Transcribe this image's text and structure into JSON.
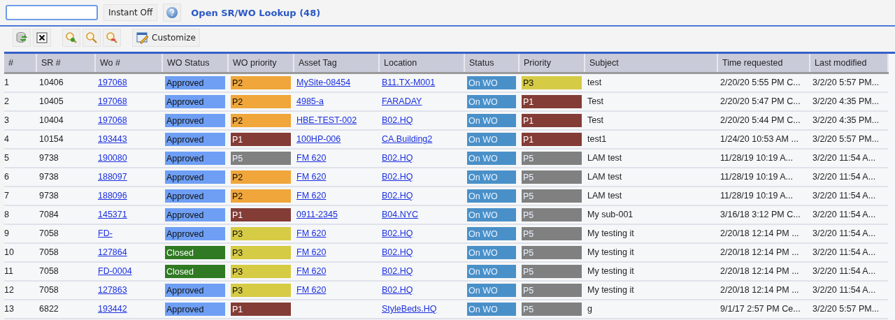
{
  "instant_button": "Instant Off",
  "title": "Open SR/WO Lookup (48)",
  "toolbar": {
    "customize": "Customize"
  },
  "table": {
    "columns": [
      "#",
      "SR #",
      "Wo #",
      "WO Status",
      "WO priority",
      "Asset Tag",
      "Location",
      "Status",
      "Priority",
      "Subject",
      "Time requested",
      "Last modified"
    ],
    "rows": [
      {
        "n": "1",
        "sr": "10406",
        "wo": "197068",
        "wo_status": {
          "text": "Approved",
          "color": "#6e9ff5"
        },
        "wo_priority": {
          "text": "P2",
          "color": "#f0a63a"
        },
        "asset_tag": "MySite-08454",
        "location": "B11.TX-M001",
        "status": {
          "text": "On WO",
          "color": "#4a90c8"
        },
        "priority": {
          "text": "P3",
          "color": "#d6cb45"
        },
        "subject": "test",
        "time_requested": "2/20/20 5:55 PM C...",
        "last_modified": "3/2/20 5:57 PM..."
      },
      {
        "n": "2",
        "sr": "10405",
        "wo": "197068",
        "wo_status": {
          "text": "Approved",
          "color": "#6e9ff5"
        },
        "wo_priority": {
          "text": "P2",
          "color": "#f0a63a"
        },
        "asset_tag": "4985-a",
        "location": "FARADAY",
        "status": {
          "text": "On WO",
          "color": "#4a90c8"
        },
        "priority": {
          "text": "P1",
          "color": "#843c36"
        },
        "subject": "Test",
        "time_requested": "2/20/20 5:47 PM C...",
        "last_modified": "3/2/20 4:35 PM..."
      },
      {
        "n": "3",
        "sr": "10404",
        "wo": "197068",
        "wo_status": {
          "text": "Approved",
          "color": "#6e9ff5"
        },
        "wo_priority": {
          "text": "P2",
          "color": "#f0a63a"
        },
        "asset_tag": "HBE-TEST-002",
        "location": "B02.HQ",
        "status": {
          "text": "On WO",
          "color": "#4a90c8"
        },
        "priority": {
          "text": "P1",
          "color": "#843c36"
        },
        "subject": "Test",
        "time_requested": "2/20/20 5:44 PM C...",
        "last_modified": "3/2/20 4:35 PM..."
      },
      {
        "n": "4",
        "sr": "10154",
        "wo": "193443",
        "wo_status": {
          "text": "Approved",
          "color": "#6e9ff5"
        },
        "wo_priority": {
          "text": "P1",
          "color": "#843c36"
        },
        "asset_tag": "100HP-006",
        "location": "CA.Building2",
        "status": {
          "text": "On WO",
          "color": "#4a90c8"
        },
        "priority": {
          "text": "P1",
          "color": "#843c36"
        },
        "subject": "test1",
        "time_requested": "1/24/20 10:53 AM ...",
        "last_modified": "3/2/20 5:57 PM..."
      },
      {
        "n": "5",
        "sr": "9738",
        "wo": "190080",
        "wo_status": {
          "text": "Approved",
          "color": "#6e9ff5"
        },
        "wo_priority": {
          "text": "P5",
          "color": "#808080"
        },
        "asset_tag": "FM 620",
        "location": "B02.HQ",
        "status": {
          "text": "On WO",
          "color": "#4a90c8"
        },
        "priority": {
          "text": "P5",
          "color": "#808080"
        },
        "subject": "LAM test",
        "time_requested": "11/28/19 10:19 A...",
        "last_modified": "3/2/20 11:54 A..."
      },
      {
        "n": "6",
        "sr": "9738",
        "wo": "188097",
        "wo_status": {
          "text": "Approved",
          "color": "#6e9ff5"
        },
        "wo_priority": {
          "text": "P2",
          "color": "#f0a63a"
        },
        "asset_tag": "FM 620",
        "location": "B02.HQ",
        "status": {
          "text": "On WO",
          "color": "#4a90c8"
        },
        "priority": {
          "text": "P5",
          "color": "#808080"
        },
        "subject": "LAM test",
        "time_requested": "11/28/19 10:19 A...",
        "last_modified": "3/2/20 11:54 A..."
      },
      {
        "n": "7",
        "sr": "9738",
        "wo": "188096",
        "wo_status": {
          "text": "Approved",
          "color": "#6e9ff5"
        },
        "wo_priority": {
          "text": "P2",
          "color": "#f0a63a"
        },
        "asset_tag": "FM 620",
        "location": "B02.HQ",
        "status": {
          "text": "On WO",
          "color": "#4a90c8"
        },
        "priority": {
          "text": "P5",
          "color": "#808080"
        },
        "subject": "LAM test",
        "time_requested": "11/28/19 10:19 A...",
        "last_modified": "3/2/20 11:54 A..."
      },
      {
        "n": "8",
        "sr": "7084",
        "wo": "145371",
        "wo_status": {
          "text": "Approved",
          "color": "#6e9ff5"
        },
        "wo_priority": {
          "text": "P1",
          "color": "#843c36"
        },
        "asset_tag": "0911-2345",
        "location": "B04.NYC",
        "status": {
          "text": "On WO",
          "color": "#4a90c8"
        },
        "priority": {
          "text": "P5",
          "color": "#808080"
        },
        "subject": "My sub-001",
        "time_requested": "3/16/18 3:12 PM C...",
        "last_modified": "3/2/20 11:54 A..."
      },
      {
        "n": "9",
        "sr": "7058",
        "wo": "FD-",
        "wo_status": {
          "text": "Approved",
          "color": "#6e9ff5"
        },
        "wo_priority": {
          "text": "P3",
          "color": "#d6cb45"
        },
        "asset_tag": "FM 620",
        "location": "B02.HQ",
        "status": {
          "text": "On WO",
          "color": "#4a90c8"
        },
        "priority": {
          "text": "P5",
          "color": "#808080"
        },
        "subject": "My testing it",
        "time_requested": "2/20/18 12:14 PM ...",
        "last_modified": "3/2/20 11:54 A..."
      },
      {
        "n": "10",
        "sr": "7058",
        "wo": "127864",
        "wo_status": {
          "text": "Closed",
          "color": "#2f7a22"
        },
        "wo_priority": {
          "text": "P3",
          "color": "#d6cb45"
        },
        "asset_tag": "FM 620",
        "location": "B02.HQ",
        "status": {
          "text": "On WO",
          "color": "#4a90c8"
        },
        "priority": {
          "text": "P5",
          "color": "#808080"
        },
        "subject": "My testing it",
        "time_requested": "2/20/18 12:14 PM ...",
        "last_modified": "3/2/20 11:54 A..."
      },
      {
        "n": "11",
        "sr": "7058",
        "wo": "FD-0004",
        "wo_status": {
          "text": "Closed",
          "color": "#2f7a22"
        },
        "wo_priority": {
          "text": "P3",
          "color": "#d6cb45"
        },
        "asset_tag": "FM 620",
        "location": "B02.HQ",
        "status": {
          "text": "On WO",
          "color": "#4a90c8"
        },
        "priority": {
          "text": "P5",
          "color": "#808080"
        },
        "subject": "My testing it",
        "time_requested": "2/20/18 12:14 PM ...",
        "last_modified": "3/2/20 11:54 A..."
      },
      {
        "n": "12",
        "sr": "7058",
        "wo": "127863",
        "wo_status": {
          "text": "Approved",
          "color": "#6e9ff5"
        },
        "wo_priority": {
          "text": "P3",
          "color": "#d6cb45"
        },
        "asset_tag": "FM 620",
        "location": "B02.HQ",
        "status": {
          "text": "On WO",
          "color": "#4a90c8"
        },
        "priority": {
          "text": "P5",
          "color": "#808080"
        },
        "subject": "My testing it",
        "time_requested": "2/20/18 12:14 PM ...",
        "last_modified": "3/2/20 11:54 A..."
      },
      {
        "n": "13",
        "sr": "6822",
        "wo": "193442",
        "wo_status": {
          "text": "Approved",
          "color": "#6e9ff5"
        },
        "wo_priority": {
          "text": "P1",
          "color": "#843c36"
        },
        "location": "StyleBeds.HQ",
        "status": {
          "text": "On WO",
          "color": "#4a90c8"
        },
        "priority": {
          "text": "P5",
          "color": "#808080"
        },
        "subject": "g",
        "time_requested": "9/1/17 2:57 PM Ce...",
        "last_modified": "3/2/20 5:57 PM..."
      }
    ]
  }
}
